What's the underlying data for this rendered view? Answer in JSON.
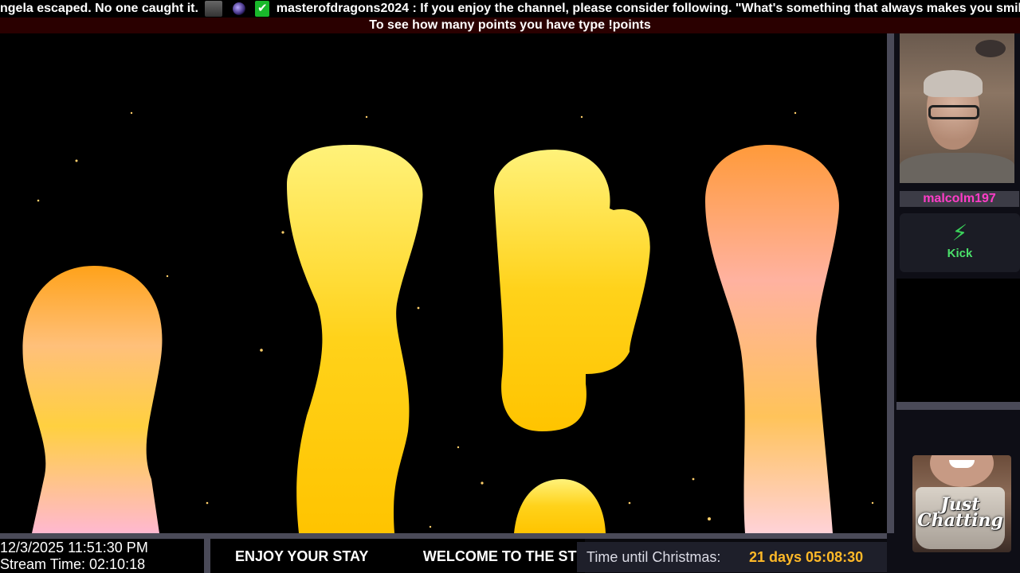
{
  "ticker": {
    "text_1": "ngela escaped. No one caught it.",
    "emote_1": "skull-emote",
    "emote_2": "orb-emote",
    "emote_3": "check-emote",
    "check_glyph": "✔",
    "username": "masterofdragons2024",
    "separator": ":",
    "message": " If you enjoy the channel, please consider following.  \"What's something that always makes you smile?\""
  },
  "points_banner": "To see how many points you have type !points",
  "streamer": {
    "name": "malcolm197",
    "webcam_icon": "webcam-feed"
  },
  "platform_card": {
    "icon": "lightning-bolt-icon",
    "bolt_glyph": "⚡",
    "label": "Kick"
  },
  "category": {
    "name": "Just Chatting",
    "line_1": "Just",
    "line_2": "Chatting"
  },
  "bottom": {
    "date_time": "12/3/2025 11:51:30 PM",
    "stream_time": "Stream Time: 02:10:18",
    "marquee_1": "ENJOY YOUR STAY",
    "marquee_2": "WELCOME TO THE ST",
    "countdown_label": "Time until Christmas:",
    "countdown_value": "21 days 05:08:30"
  },
  "colors": {
    "username_pink": "#ff3cc8",
    "kick_green": "#4be06a",
    "countdown_orange": "#ffb928",
    "points_bar_bg": "#2a0000"
  }
}
